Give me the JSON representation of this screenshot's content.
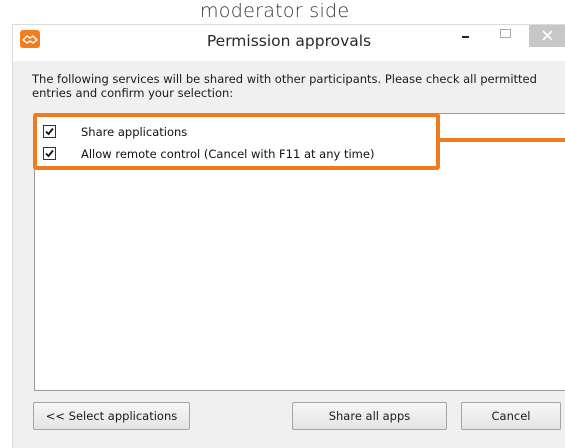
{
  "caption": "moderator side",
  "window": {
    "title": "Permission approvals",
    "app_icon": "handshake-app-icon",
    "controls": {
      "minimize_icon": "minimize-icon",
      "maximize_icon": "maximize-icon",
      "close_icon": "close-icon"
    }
  },
  "description": {
    "line1": "The following services will be shared with other participants. Please check all permitted",
    "line2": "entries and confirm your selection:"
  },
  "permissions": [
    {
      "label": "Share applications",
      "checked": true
    },
    {
      "label": "Allow remote control (Cancel with F11 at any time)",
      "checked": true
    }
  ],
  "buttons": {
    "select_label": "<< Select applications",
    "share_label": "Share all apps",
    "cancel_label": "Cancel"
  },
  "colors": {
    "highlight": "#f07a1e",
    "app_icon": "#f47b20",
    "close_button": "#c7c7c7"
  }
}
